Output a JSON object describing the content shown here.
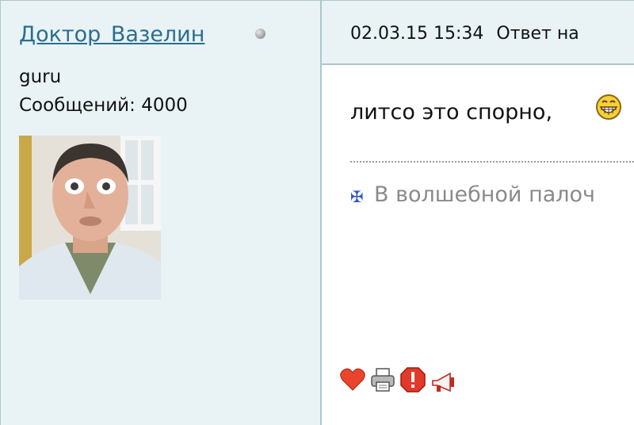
{
  "author": {
    "name": "Доктор Вазелин",
    "rank": "guru",
    "post_count_label": "Сообщений: 4000"
  },
  "post": {
    "date": "02.03.15 15:34",
    "reply_label": "Ответ на",
    "text": "литсо это спорно,",
    "signature": "В волшебной палоч"
  },
  "icons": {
    "status": "status-offline-icon",
    "smiley": "grin-smiley-icon",
    "signature": "cross-icon",
    "actions": [
      "heart-icon",
      "print-icon",
      "warning-icon",
      "megaphone-icon"
    ]
  },
  "colors": {
    "sidebar_bg": "#e9f3f5",
    "border": "#a9c8cc",
    "username_link": "#2a6e8e",
    "signature_text": "#8a8a8a"
  }
}
